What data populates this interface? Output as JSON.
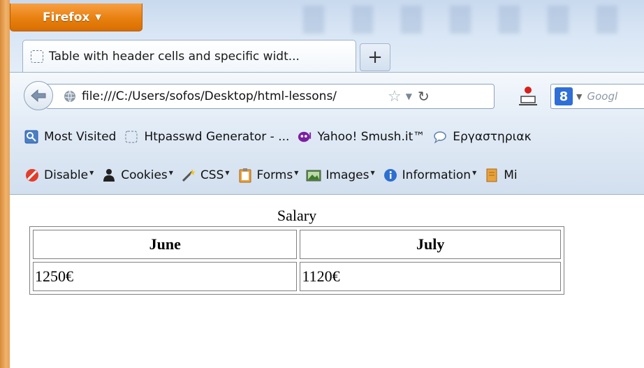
{
  "browser": {
    "menu_button_label": "Firefox",
    "tab_title": "Table with header cells and specific widt...",
    "new_tab_label": "+",
    "url": "file:///C:/Users/sofos/Desktop/html-lessons/",
    "search_placeholder": "Googl",
    "search_engine_letter": "8"
  },
  "bookmarks": [
    {
      "label": "Most Visited",
      "icon": "most-visited-icon"
    },
    {
      "label": "Htpasswd Generator - ...",
      "icon": "page-icon"
    },
    {
      "label": "Yahoo! Smush.it™",
      "icon": "yahoo-icon"
    },
    {
      "label": "Εργαστηριακ",
      "icon": "chat-icon"
    }
  ],
  "devtools": [
    {
      "label": "Disable",
      "icon": "disable-icon"
    },
    {
      "label": "Cookies",
      "icon": "cookies-icon"
    },
    {
      "label": "CSS",
      "icon": "css-icon"
    },
    {
      "label": "Forms",
      "icon": "forms-icon"
    },
    {
      "label": "Images",
      "icon": "images-icon"
    },
    {
      "label": "Information",
      "icon": "information-icon"
    },
    {
      "label": "Mi",
      "icon": "misc-icon"
    }
  ],
  "page": {
    "caption": "Salary",
    "headers": [
      "June",
      "July"
    ],
    "rows": [
      [
        "1250€",
        "1120€"
      ]
    ]
  },
  "colors": {
    "firefox_orange": "#e8800f",
    "chrome_blue": "#dce8f5"
  }
}
